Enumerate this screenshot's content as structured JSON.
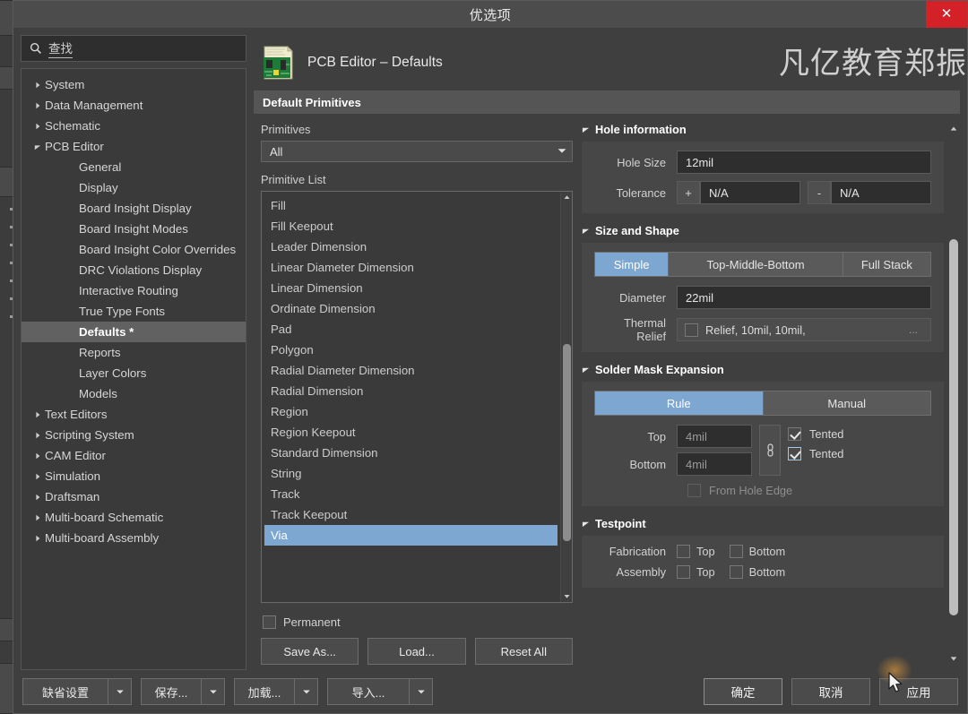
{
  "window": {
    "title": "优选项",
    "close_label": "✕",
    "watermark": "凡亿教育郑振"
  },
  "search": {
    "placeholder": "查找",
    "icon": "search-icon"
  },
  "sidebar": {
    "items": [
      {
        "label": "System",
        "level": 1,
        "expandable": true,
        "expanded": false
      },
      {
        "label": "Data Management",
        "level": 1,
        "expandable": true,
        "expanded": false
      },
      {
        "label": "Schematic",
        "level": 1,
        "expandable": true,
        "expanded": false
      },
      {
        "label": "PCB Editor",
        "level": 1,
        "expandable": true,
        "expanded": true
      },
      {
        "label": "General",
        "level": 2,
        "expandable": false
      },
      {
        "label": "Display",
        "level": 2,
        "expandable": false
      },
      {
        "label": "Board Insight Display",
        "level": 2,
        "expandable": false
      },
      {
        "label": "Board Insight Modes",
        "level": 2,
        "expandable": false
      },
      {
        "label": "Board Insight Color Overrides",
        "level": 2,
        "expandable": false
      },
      {
        "label": "DRC Violations Display",
        "level": 2,
        "expandable": false
      },
      {
        "label": "Interactive Routing",
        "level": 2,
        "expandable": false
      },
      {
        "label": "True Type Fonts",
        "level": 2,
        "expandable": false
      },
      {
        "label": "Defaults *",
        "level": 2,
        "expandable": false,
        "selected": true
      },
      {
        "label": "Reports",
        "level": 2,
        "expandable": false
      },
      {
        "label": "Layer Colors",
        "level": 2,
        "expandable": false
      },
      {
        "label": "Models",
        "level": 2,
        "expandable": false
      },
      {
        "label": "Text Editors",
        "level": 1,
        "expandable": true,
        "expanded": false
      },
      {
        "label": "Scripting System",
        "level": 1,
        "expandable": true,
        "expanded": false
      },
      {
        "label": "CAM Editor",
        "level": 1,
        "expandable": true,
        "expanded": false
      },
      {
        "label": "Simulation",
        "level": 1,
        "expandable": true,
        "expanded": false
      },
      {
        "label": "Draftsman",
        "level": 1,
        "expandable": true,
        "expanded": false
      },
      {
        "label": "Multi-board Schematic",
        "level": 1,
        "expandable": true,
        "expanded": false
      },
      {
        "label": "Multi-board Assembly",
        "level": 1,
        "expandable": true,
        "expanded": false
      }
    ]
  },
  "page": {
    "icon": "pcb-board-icon",
    "title": "PCB Editor – Defaults",
    "section_title": "Default Primitives"
  },
  "primitives": {
    "filter_label": "Primitives",
    "filter_value": "All",
    "list_label": "Primitive List",
    "items": [
      "Fill",
      "Fill Keepout",
      "Leader Dimension",
      "Linear Diameter Dimension",
      "Linear Dimension",
      "Ordinate Dimension",
      "Pad",
      "Polygon",
      "Radial Diameter Dimension",
      "Radial Dimension",
      "Region",
      "Region Keepout",
      "Standard Dimension",
      "String",
      "Track",
      "Track Keepout",
      "Via"
    ],
    "selected": "Via",
    "permanent_label": "Permanent",
    "permanent_checked": false,
    "buttons": {
      "save_as": "Save As...",
      "load": "Load...",
      "reset_all": "Reset All"
    }
  },
  "hole_information": {
    "title": "Hole information",
    "hole_size_label": "Hole Size",
    "hole_size_value": "12mil",
    "tolerance_label": "Tolerance",
    "tolerance_plus_sign": "+",
    "tolerance_plus_value": "N/A",
    "tolerance_minus_sign": "-",
    "tolerance_minus_value": "N/A"
  },
  "size_and_shape": {
    "title": "Size and Shape",
    "modes": [
      "Simple",
      "Top-Middle-Bottom",
      "Full Stack"
    ],
    "active_mode": "Simple",
    "diameter_label": "Diameter",
    "diameter_value": "22mil",
    "thermal_relief_label": "Thermal Relief",
    "thermal_relief_checked": false,
    "thermal_relief_value": "Relief, 10mil, 10mil, ",
    "ellipsis": "..."
  },
  "solder_mask_expansion": {
    "title": "Solder Mask Expansion",
    "modes": [
      "Rule",
      "Manual"
    ],
    "active_mode": "Rule",
    "top_label": "Top",
    "top_value": "4mil",
    "bottom_label": "Bottom",
    "bottom_value": "4mil",
    "link_icon": "link-chain-icon",
    "top_tented_label": "Tented",
    "top_tented_checked": true,
    "bottom_tented_label": "Tented",
    "bottom_tented_checked": true,
    "from_hole_edge_label": "From Hole Edge",
    "from_hole_edge_checked": false
  },
  "testpoint": {
    "title": "Testpoint",
    "fabrication_label": "Fabrication",
    "fabrication_top_label": "Top",
    "fabrication_top_checked": false,
    "fabrication_bottom_label": "Bottom",
    "fabrication_bottom_checked": false,
    "assembly_label": "Assembly",
    "assembly_top_label": "Top",
    "assembly_top_checked": false,
    "assembly_bottom_label": "Bottom",
    "assembly_bottom_checked": false
  },
  "footer": {
    "default_settings": "缺省设置",
    "save": "保存...",
    "load": "加载...",
    "import": "导入...",
    "ok": "确定",
    "cancel": "取消",
    "apply": "应用"
  },
  "colors": {
    "accent": "#7da7d0",
    "close_red": "#d42027",
    "dialog_bg": "#3f3f3f",
    "panel_bg": "#474747",
    "input_bg": "#2e2e2e"
  }
}
